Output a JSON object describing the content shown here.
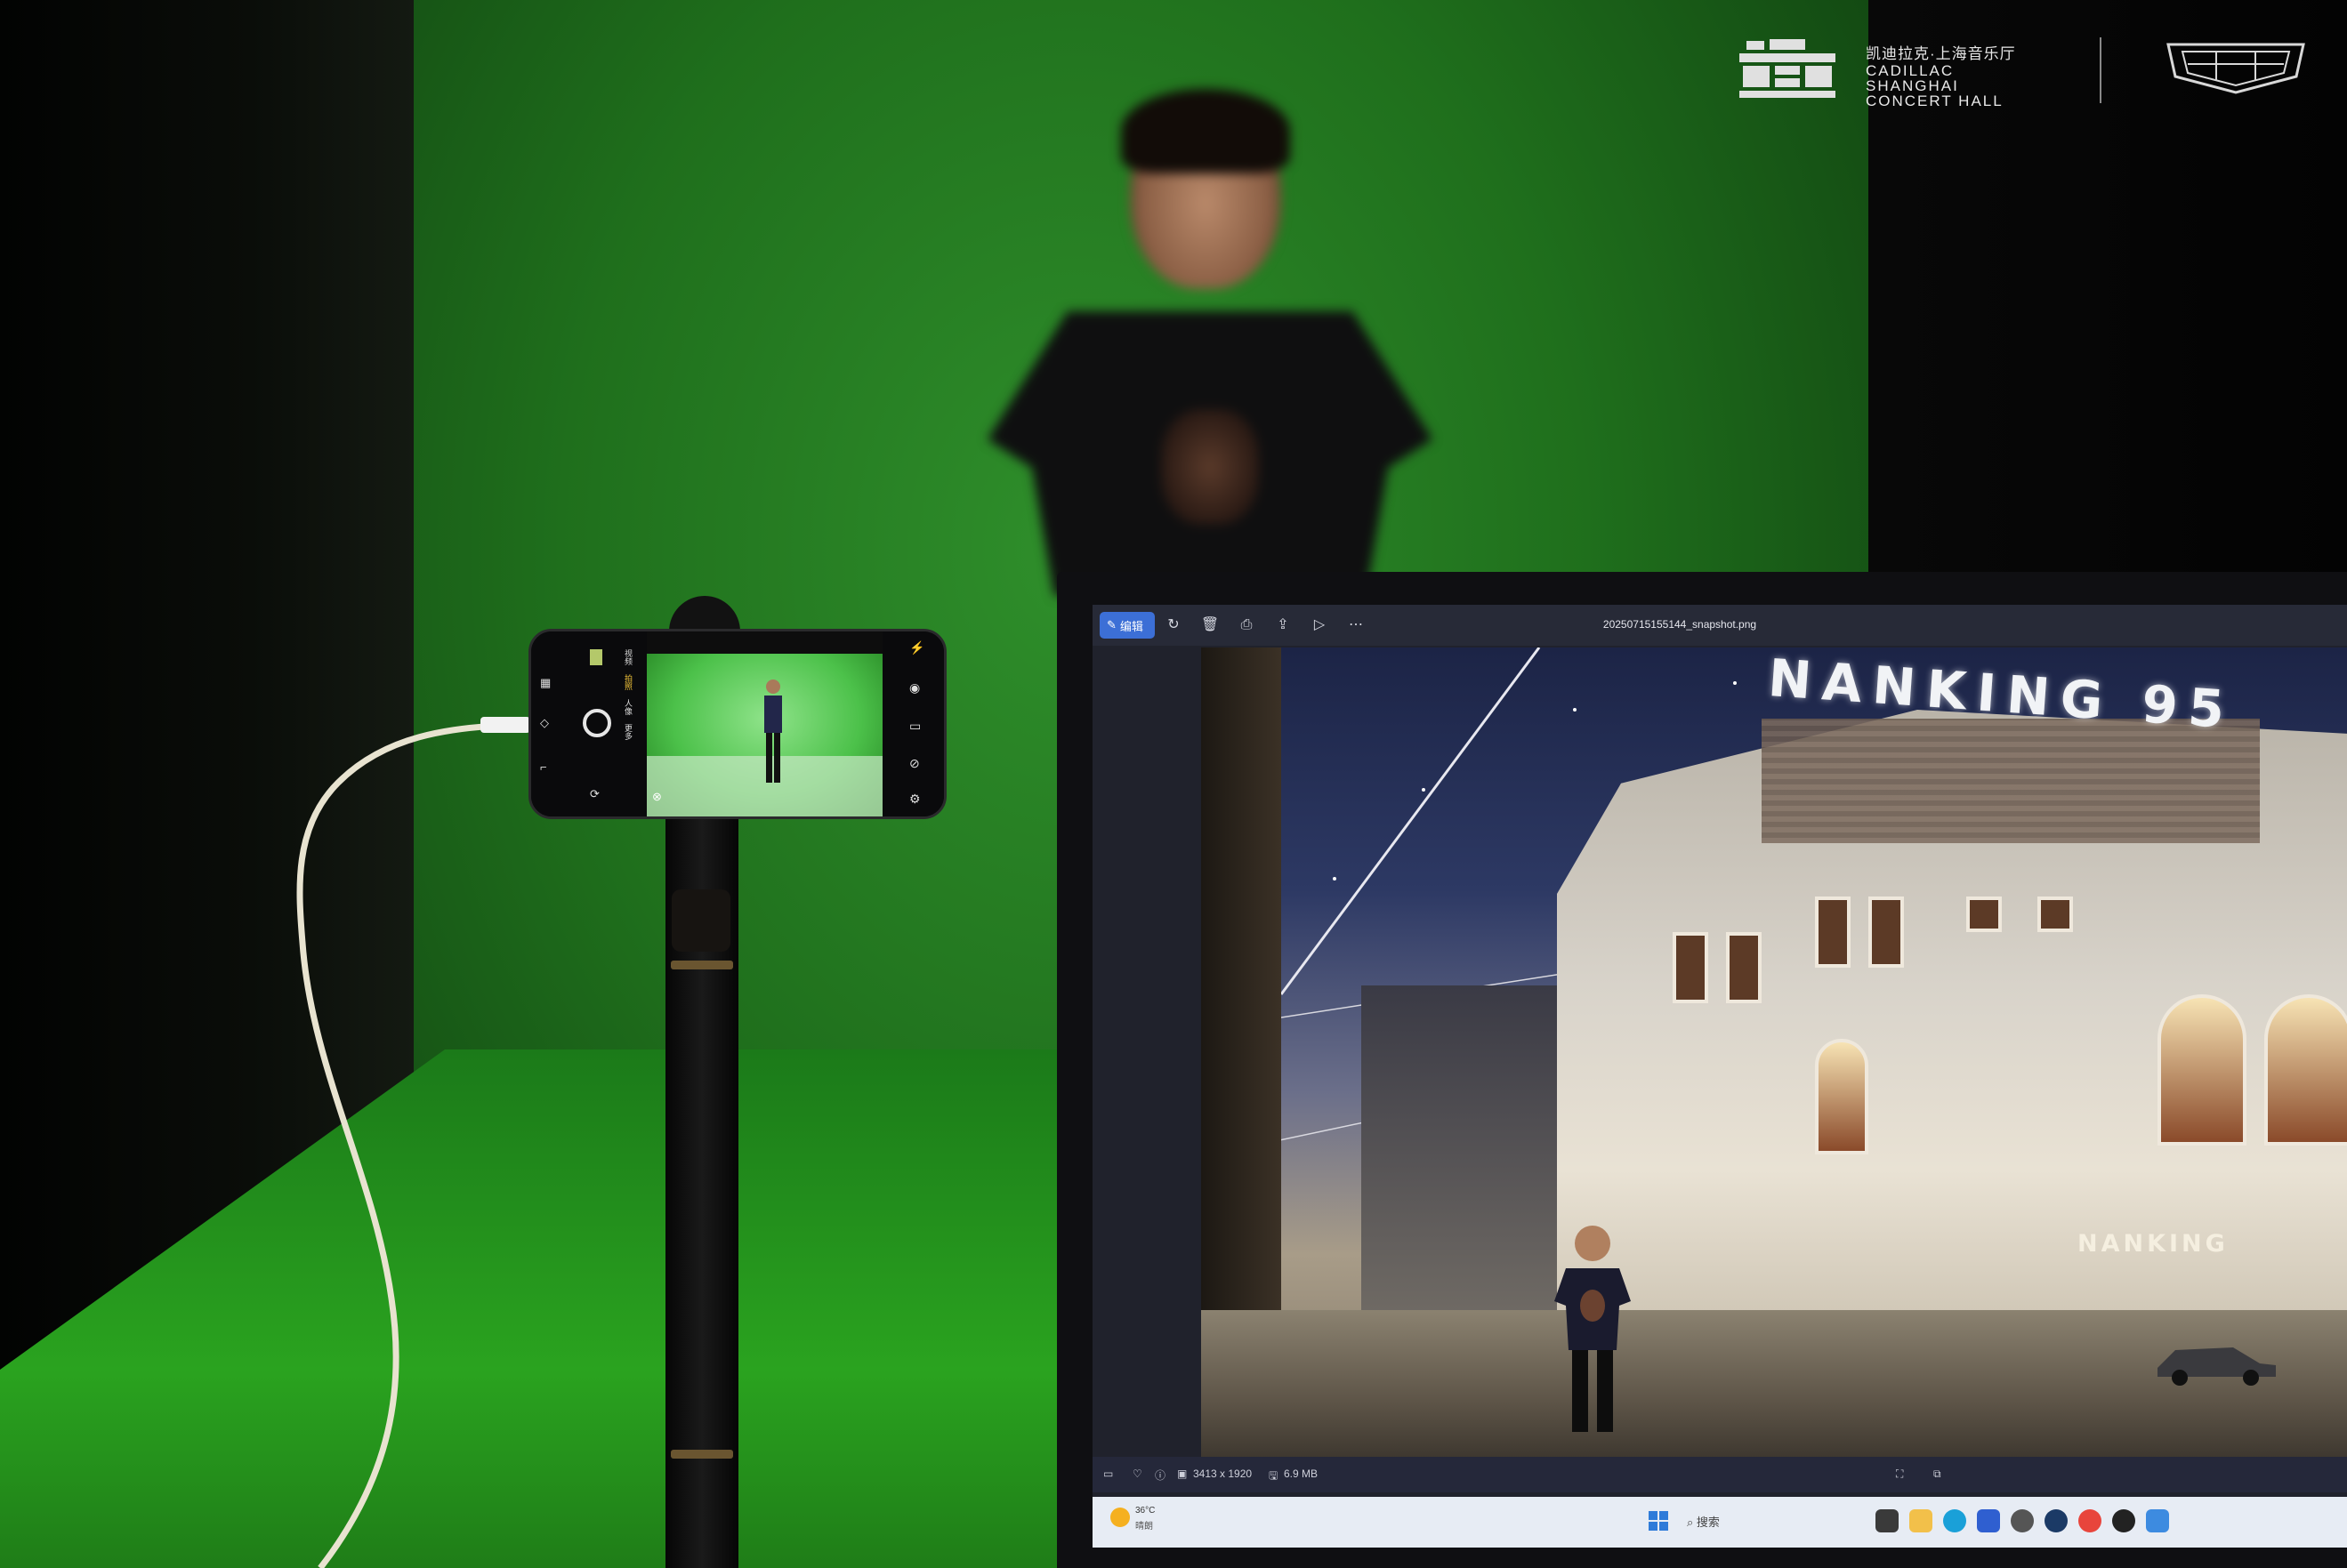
{
  "brand": {
    "cn_name": "凯迪拉克·上海音乐厅",
    "en_line1": "CADILLAC",
    "en_line2": "SHANGHAI",
    "en_line3": "CONCERT HALL"
  },
  "phone_camera": {
    "modes": [
      "",
      "",
      "视频",
      "拍照",
      "人像",
      "更多"
    ],
    "active_mode": "拍照"
  },
  "viewer_app": {
    "toolbar": {
      "edit_label": "编辑",
      "file_name": "20250715155144_snapshot.png",
      "icons": [
        "rotate-icon",
        "delete-icon",
        "print-icon",
        "share-icon",
        "slideshow-icon",
        "more-icon"
      ]
    },
    "image": {
      "sign_main": "NANKING",
      "sign_number": "95",
      "sign_secondary": "NANKING"
    },
    "statusbar": {
      "dimensions": "3413 x 1920",
      "file_size": "6.9 MB"
    }
  },
  "taskbar": {
    "weather_temp": "36°C",
    "weather_condition": "晴朗",
    "search_placeholder": "搜索"
  },
  "colors": {
    "greenscreen": "#2a8a26",
    "accent_blue": "#3c6fd6"
  }
}
